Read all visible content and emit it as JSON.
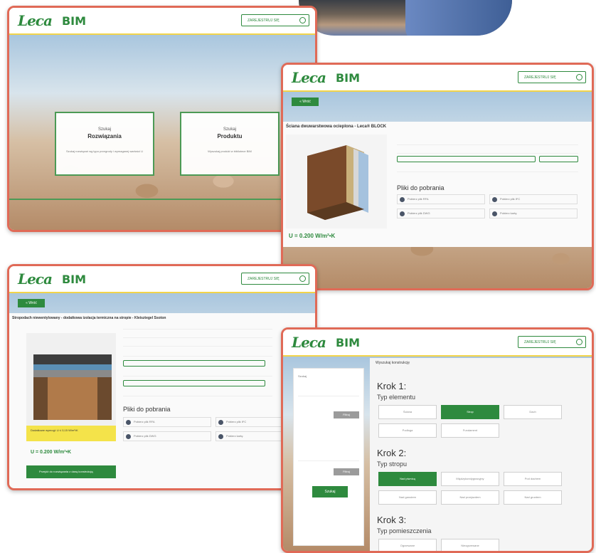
{
  "header": {
    "logo": "Leca",
    "product": "BIM",
    "register_button": "ZAREJESTRUJ SIĘ"
  },
  "shot1": {
    "cards": [
      {
        "kicker": "Szukaj",
        "title": "Rozwiązania",
        "desc": "Szukaj rozwiązań wg typu przegrody i wymaganej wartości U"
      },
      {
        "kicker": "Szukaj",
        "title": "Produktu",
        "desc": "Wyszukaj produkt w bibliotece BIM"
      }
    ]
  },
  "shot2": {
    "back": "« Wróć",
    "title": "Ściana dwuwarstwowa ocieplona - Leca® BLOCK",
    "u_value": "U = 0.200 W/m²•K",
    "files_heading": "Pliki do pobrania",
    "downloads": [
      "Pobierz plik RFA",
      "Pobierz plik IFC",
      "Pobierz plik DWG",
      "Pobierz kartę"
    ]
  },
  "shot3": {
    "back": "« Wróć",
    "title": "Stropodach niewentylowany - dodatkowa izolacja termiczna na stropie - Kleisztegel Ssoton",
    "yellow_note": "Dodatkowe wymogi: U ≤ 0,15 W/m²•K",
    "u_value": "U = 0.200 W/m²•K",
    "cta": "Przejdź do rozwiązania z daną konstrukcją",
    "files_heading": "Pliki do pobrania",
    "downloads": [
      "Pobierz plik RFA",
      "Pobierz plik IFC",
      "Pobierz plik DWG",
      "Pobierz kartę"
    ]
  },
  "shot4": {
    "tab_label": "Wyszukaj konstrukcję",
    "sidebar_search": "Szukaj",
    "sidebar_btn": "Filtruj",
    "steps": [
      {
        "krok": "Krok 1:",
        "typ": "Typ elementu",
        "options": [
          "Ściana",
          "Strop",
          "Dach",
          "Podłoga",
          "Fundament"
        ]
      },
      {
        "krok": "Krok 2:",
        "typ": "Typ stropu",
        "options": [
          "Nad piwnicą",
          "Międzykondygnacyjny",
          "Pod dachem",
          "Nad garażem",
          "Nad przejazdem",
          "Nad gruntem"
        ]
      },
      {
        "krok": "Krok 3:",
        "typ": "Typ pomieszczenia",
        "options": [
          "Ogrzewane",
          "Nieogrzewane"
        ]
      }
    ]
  },
  "colors": {
    "brand_green": "#2e8a3e",
    "accent_yellow": "#f2d44a",
    "frame_red": "#e06a57"
  }
}
